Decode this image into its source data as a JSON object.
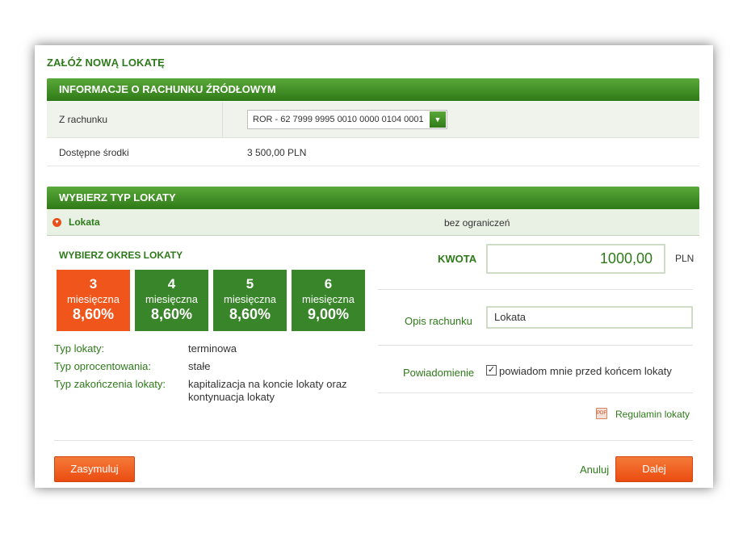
{
  "page": {
    "title": "ZAŁÓŻ NOWĄ LOKATĘ"
  },
  "source_section": {
    "header": "INFORMACJE O RACHUNKU ŹRÓDŁOWYM",
    "from_account_label": "Z rachunku",
    "from_account_value": "ROR - 62 7999 9995 0010 0000 0104 0001",
    "available_label": "Dostępne środki",
    "available_value": "3 500,00 PLN"
  },
  "type_section": {
    "header": "WYBIERZ TYP LOKATY",
    "deposit_name": "Lokata",
    "deposit_limit": "bez ograniczeń"
  },
  "period_section": {
    "title": "WYBIERZ OKRES LOKATY",
    "options": [
      {
        "months": "3",
        "unit": "miesięczna",
        "rate": "8,60%",
        "selected": true
      },
      {
        "months": "4",
        "unit": "miesięczna",
        "rate": "8,60%",
        "selected": false
      },
      {
        "months": "5",
        "unit": "miesięczna",
        "rate": "8,60%",
        "selected": false
      },
      {
        "months": "6",
        "unit": "miesięczna",
        "rate": "9,00%",
        "selected": false
      }
    ]
  },
  "details": {
    "type_label": "Typ lokaty:",
    "type_value": "terminowa",
    "interest_label": "Typ oprocentowania:",
    "interest_value": "stałe",
    "end_label": "Typ zakończenia lokaty:",
    "end_value": "kapitalizacja na koncie lokaty oraz kontynuacja lokaty"
  },
  "form": {
    "amount_label": "KWOTA",
    "amount_value": "1000,00",
    "currency": "PLN",
    "description_label": "Opis rachunku",
    "description_value": "Lokata",
    "notification_label": "Powiadomienie",
    "notification_checked": true,
    "notification_text": "powiadom mnie przed końcem lokaty",
    "terms_icon": "pdf-icon",
    "terms_link": "Regulamin lokaty"
  },
  "buttons": {
    "simulate": "Zasymuluj",
    "cancel": "Anuluj",
    "next": "Dalej"
  },
  "colors": {
    "brand_green": "#2e7a1a",
    "header_green": "#3f8f24",
    "accent_orange": "#f0561b",
    "period_green": "#39862a"
  }
}
